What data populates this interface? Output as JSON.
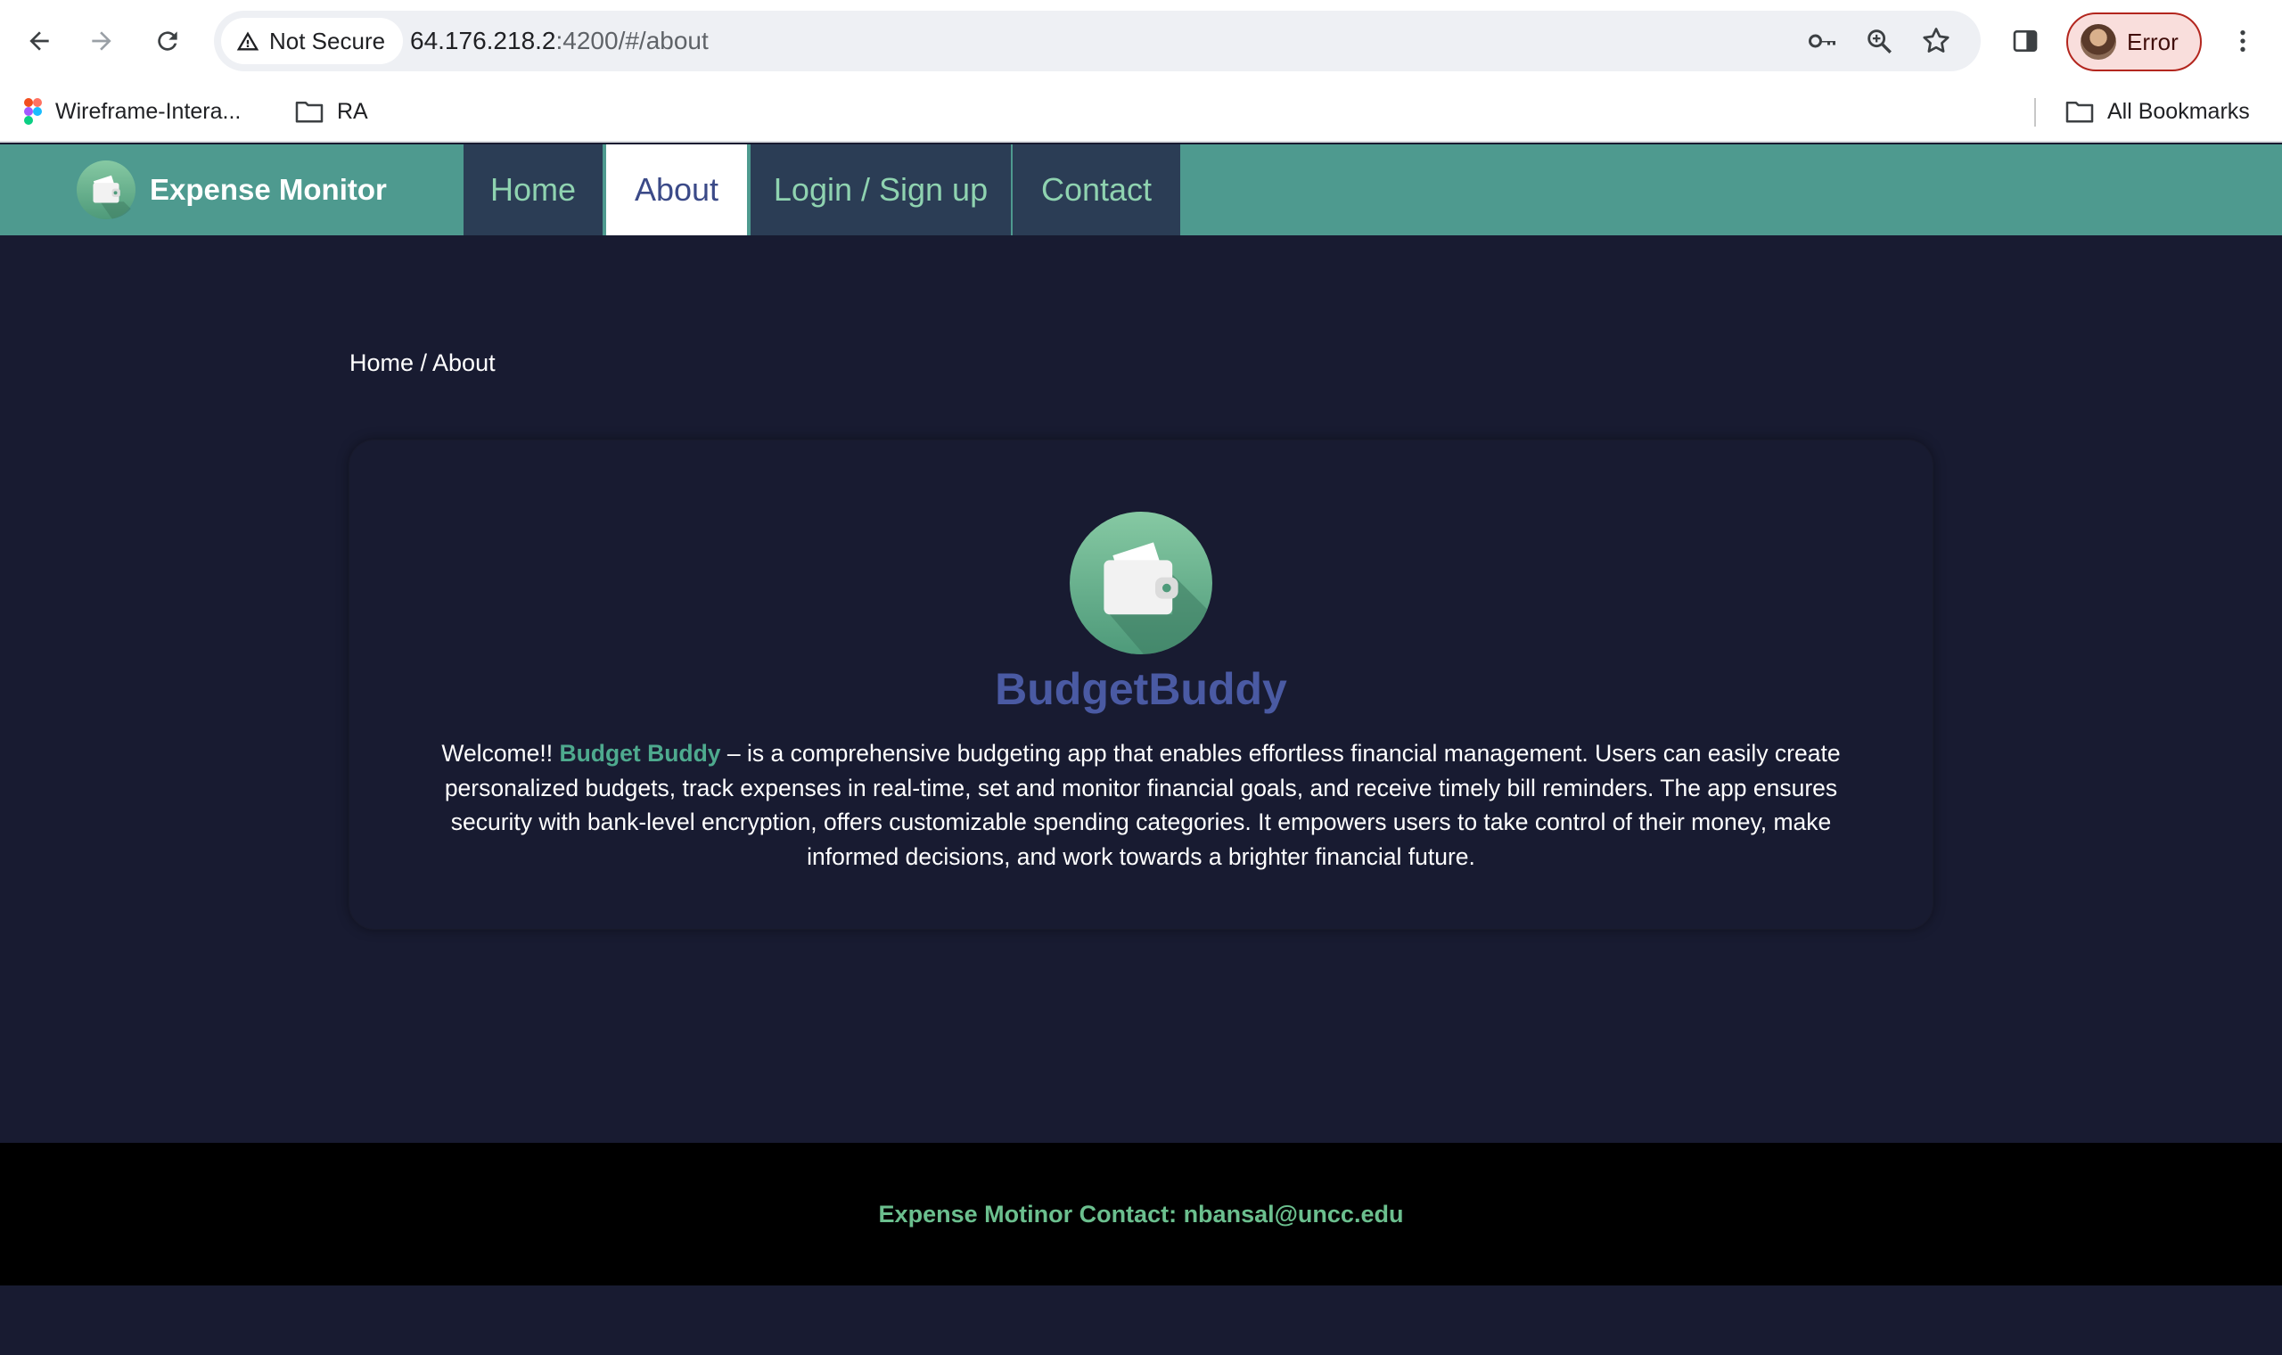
{
  "browser": {
    "security_label": "Not Secure",
    "url_host": "64.176.218.2",
    "url_rest": ":4200/#/about",
    "profile_label": "Error",
    "bookmarks": [
      {
        "label": "Wireframe-Intera...",
        "icon": "figma-icon"
      },
      {
        "label": "RA",
        "icon": "folder-icon"
      }
    ],
    "all_bookmarks_label": "All Bookmarks"
  },
  "nav": {
    "brand": "Expense Monitor",
    "tabs": [
      {
        "label": "Home",
        "active": false
      },
      {
        "label": "About",
        "active": true
      },
      {
        "label": "Login / Sign up",
        "active": false
      },
      {
        "label": "Contact",
        "active": false
      }
    ]
  },
  "page": {
    "breadcrumb": "Home / About",
    "title": "BudgetBuddy",
    "intro_prefix": "Welcome!! ",
    "intro_highlight": "Budget Buddy",
    "intro_body": " – is a comprehensive budgeting app that enables effortless financial management. Users can easily create personalized budgets, track expenses in real-time, set and monitor financial goals, and receive timely bill reminders. The app ensures security with bank-level encryption, offers customizable spending categories. It empowers users to take control of their money, make informed decisions, and work towards a brighter financial future."
  },
  "footer": {
    "text": "Expense Motinor Contact: nbansal@uncc.edu"
  },
  "colors": {
    "navbar": "#4e9a8f",
    "tab_bg": "#2b3d55",
    "tab_text": "#8fd3b0",
    "page_bg": "#181b31",
    "title": "#4a5aa3",
    "highlight": "#4eaa8e",
    "footer_text": "#6bbf8e"
  }
}
